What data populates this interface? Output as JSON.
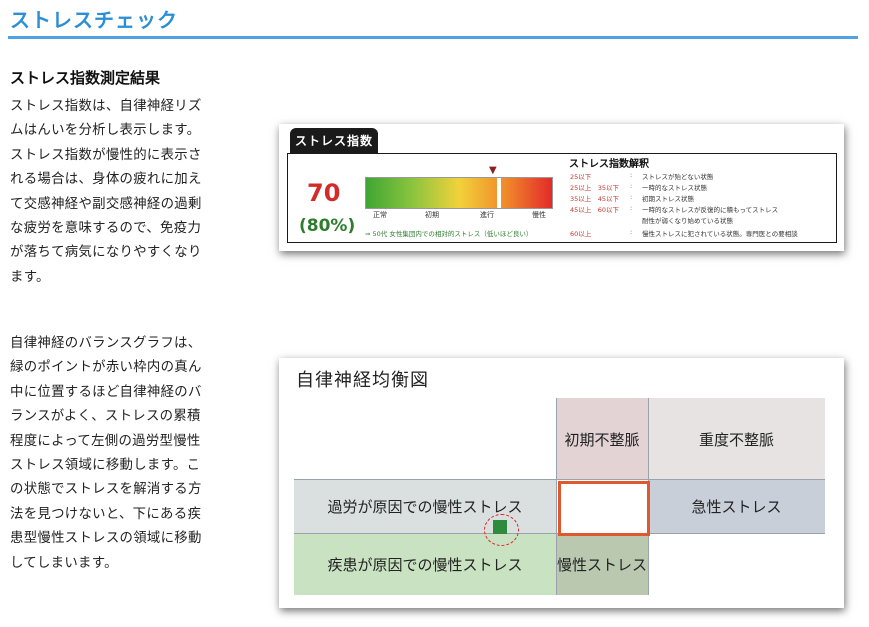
{
  "page": {
    "title": "ストレスチェック",
    "section_heading": "ストレス指数測定結果",
    "para1_lines": [
      "ストレス指数は、自律神経リズ",
      "ムはんいを分析し表示します。",
      "ストレス指数が慢性的に表示さ",
      "れる場合は、身体の疲れに加え",
      "て交感神経や副交感神経の過剰",
      "な疲労を意味するので、免疫力",
      "が落ちて病気になりやすくなり",
      "ます。"
    ],
    "para2_lines": [
      "自律神経のバランスグラフは、",
      "緑のポイントが赤い枠内の真ん",
      "中に位置するほど自律神経のバ",
      "ランスがよく、ストレスの累積",
      "程度によって左側の過労型慢性",
      "ストレス領域に移動します。こ",
      "の状態でストレスを解消する方",
      "法を見つけないと、下にある疾",
      "患型慢性ストレスの領域に移動",
      "してしまいます。"
    ]
  },
  "stress_card": {
    "tab_label": "ストレス指数",
    "score": "70",
    "percent": "(80%)",
    "gauge_value": 70,
    "gauge_labels": [
      "正常",
      "初期",
      "進行",
      "慢性"
    ],
    "note": "⇒ 50代 女性集団内での相対的ストレス（低いほど良い）",
    "interp_title": "ストレス指数解釈",
    "interp_rows": [
      {
        "range": "25以下",
        "sep": ":",
        "desc": "ストレスが殆どない状態"
      },
      {
        "range": "25以上　35以下",
        "sep": ":",
        "desc": "一時的なストレス状態"
      },
      {
        "range": "35以上　45以下",
        "sep": ":",
        "desc": "初期ストレス状態"
      },
      {
        "range": "45以上　60以下",
        "sep": ":",
        "desc": "一時的なストレスが反復的に積もってストレス"
      },
      {
        "range": "60以上",
        "sep": ":",
        "desc": "慢性ストレスに犯されている状態。専門医との要相談"
      }
    ],
    "interp_sub": "耐性が弱くなり始めている状態"
  },
  "balance_card": {
    "title": "自律神経均衡図",
    "cells": {
      "initial": "初期不整脈",
      "severe": "重度不整脈",
      "overwork": "過労が原因での慢性ストレス",
      "acute": "急性ストレス",
      "disease": "疾患が原因での慢性ストレス",
      "chronic": "慢性ストレス"
    },
    "colors": {
      "frame": "#e0582e",
      "point": "#2e8b3e"
    }
  }
}
